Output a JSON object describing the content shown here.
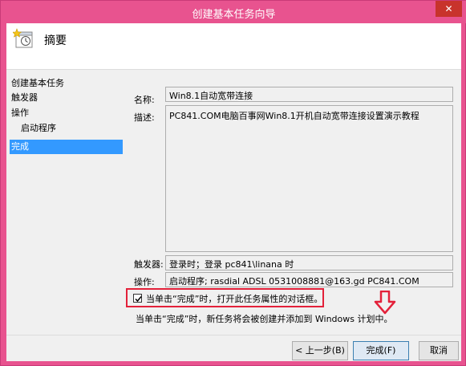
{
  "window": {
    "title": "创建基本任务向导",
    "close_glyph": "✕"
  },
  "header": {
    "title": "摘要",
    "icon": "task-scheduler-icon"
  },
  "nav": {
    "items": [
      {
        "label": "创建基本任务",
        "sub": false,
        "active": false
      },
      {
        "label": "触发器",
        "sub": false,
        "active": false
      },
      {
        "label": "操作",
        "sub": false,
        "active": false
      },
      {
        "label": "启动程序",
        "sub": true,
        "active": false
      },
      {
        "label": "完成",
        "sub": false,
        "active": true
      }
    ]
  },
  "summary": {
    "name_label": "名称:",
    "name_value": "Win8.1自动宽带连接",
    "desc_label": "描述:",
    "desc_value": "PC841.COM电脑百事网Win8.1开机自动宽带连接设置演示教程",
    "trigger_label": "触发器:",
    "trigger_value": "登录时；登录 pc841\\linana 时",
    "action_label": "操作:",
    "action_value": "启动程序; rasdial ADSL 0531008881@163.gd PC841.COM"
  },
  "open_properties": {
    "label": "当单击“完成”时，打开此任务属性的对话框。",
    "checked": true
  },
  "note": "当单击“完成”时，新任务将会被创建并添加到 Windows 计划中。",
  "buttons": {
    "back": "< 上一步(B)",
    "finish": "完成(F)",
    "cancel": "取消"
  },
  "colors": {
    "accent_frame": "#e8538f",
    "highlight": "#e3213a",
    "selection": "#3399ff"
  }
}
